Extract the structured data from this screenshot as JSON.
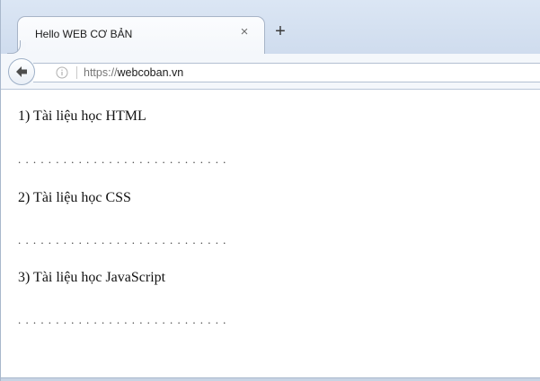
{
  "tab": {
    "title": "Hello WEB CƠ BẢN",
    "close_glyph": "×",
    "new_tab_glyph": "+"
  },
  "navbar": {
    "url_scheme": "https://",
    "url_domain": "webcoban.vn"
  },
  "content": {
    "items": [
      {
        "heading": "1) Tài liệu học HTML",
        "separator": "............................"
      },
      {
        "heading": "2) Tài liệu học CSS",
        "separator": "............................"
      },
      {
        "heading": "3) Tài liệu học JavaScript",
        "separator": "............................"
      }
    ]
  },
  "colors": {
    "tabstrip": "#dbe6f4",
    "navbar": "#f4f7fb",
    "back_arrow": "#4d4d4d"
  }
}
